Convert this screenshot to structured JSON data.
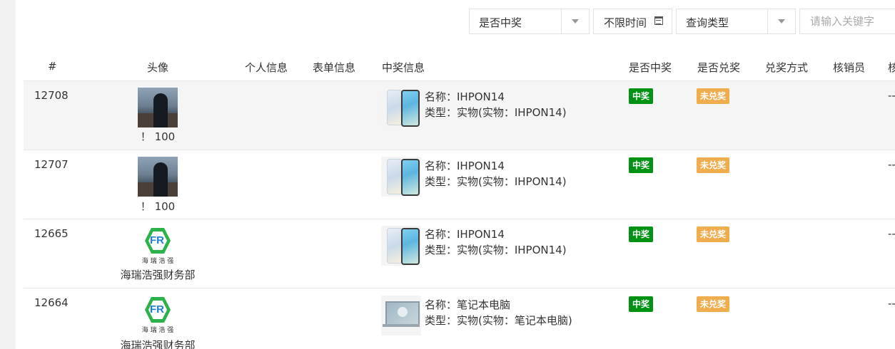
{
  "filters": {
    "winning": "是否中奖",
    "time": "不限时间",
    "query_type": "查询类型",
    "keyword_placeholder": "请输入关键字"
  },
  "columns": [
    "#",
    "头像",
    "个人信息",
    "表单信息",
    "中奖信息",
    "是否中奖",
    "是否兑奖",
    "兑奖方式",
    "核销员",
    "核"
  ],
  "rows": [
    {
      "id": "12708",
      "nickname": "！ 100",
      "prize_name": "名称：IHPON14",
      "prize_type": "类型：实物(实物：IHPON14)",
      "win_status": "中奖",
      "redeem_status": "未兑奖",
      "trailing": "--"
    },
    {
      "id": "12707",
      "nickname": "！ 100",
      "prize_name": "名称：IHPON14",
      "prize_type": "类型：实物(实物：IHPON14)",
      "win_status": "中奖",
      "redeem_status": "未兑奖",
      "trailing": "--"
    },
    {
      "id": "12665",
      "nickname": "海瑞浩强财务部",
      "logo_caption": "海 瑞 浩 强",
      "prize_name": "名称：IHPON14",
      "prize_type": "类型：实物(实物：IHPON14)",
      "win_status": "中奖",
      "redeem_status": "未兑奖",
      "trailing": "--"
    },
    {
      "id": "12664",
      "nickname": "海瑞浩强财务部",
      "logo_caption": "海 瑞 浩 强",
      "prize_name": "名称：笔记本电脑",
      "prize_type": "类型：实物(实物：笔记本电脑)",
      "win_status": "中奖",
      "redeem_status": "未兑奖",
      "trailing": "--"
    }
  ],
  "colors": {
    "win_badge": "#009213",
    "redeem_badge": "#efad4e",
    "logo_green": "#2bb34a",
    "logo_blue": "#1e7fd6"
  },
  "icons": {
    "date_filter": "calendar-icon",
    "select_caret": "chevron-down-icon"
  }
}
